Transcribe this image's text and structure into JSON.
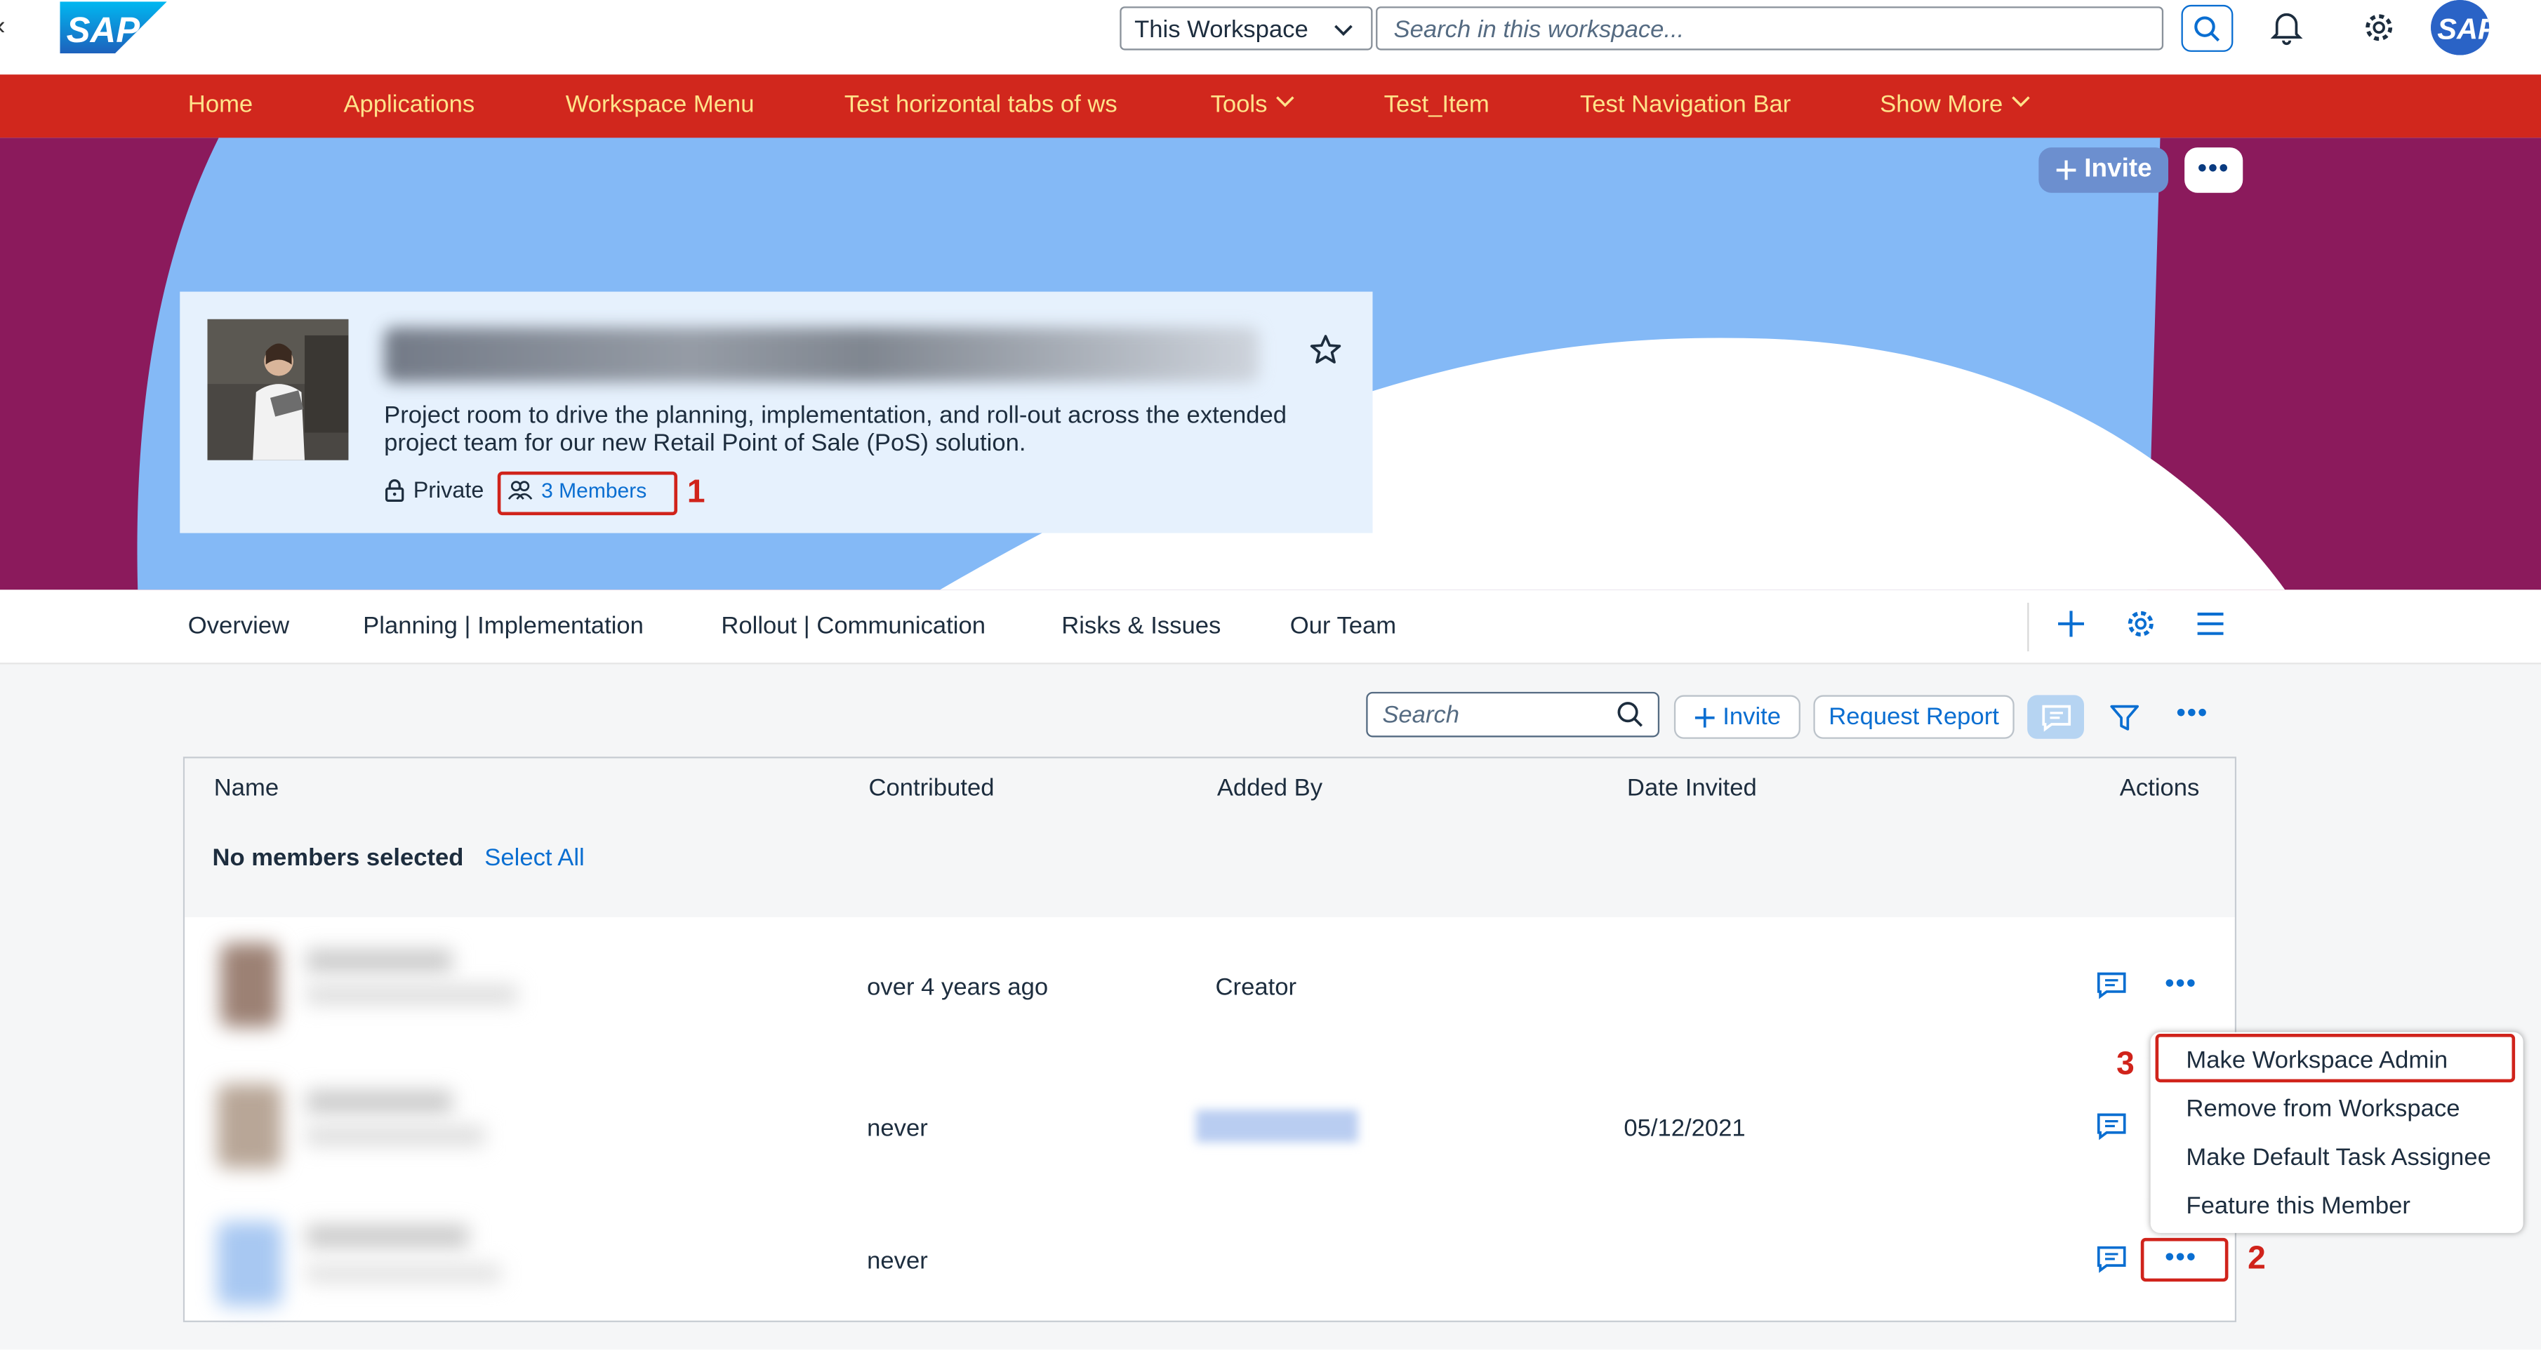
{
  "shell": {
    "scope_select": "This Workspace",
    "search_placeholder": "Search in this workspace...",
    "logo_text": "SAP"
  },
  "nav": {
    "items": [
      {
        "label": "Home"
      },
      {
        "label": "Applications"
      },
      {
        "label": "Workspace Menu"
      },
      {
        "label": "Test horizontal tabs of ws"
      },
      {
        "label": "Tools",
        "has_dropdown": true
      },
      {
        "label": "Test_Item"
      },
      {
        "label": "Test Navigation Bar"
      },
      {
        "label": "Show More",
        "has_dropdown": true
      }
    ]
  },
  "banner": {
    "invite_label": "Invite",
    "description": "Project room to drive the planning, implementation, and roll-out across the extended project team for our new Retail Point of Sale (PoS) solution.",
    "privacy": "Private",
    "members_link": "3 Members"
  },
  "tabs": [
    {
      "label": "Overview"
    },
    {
      "label": "Planning | Implementation"
    },
    {
      "label": "Rollout | Communication"
    },
    {
      "label": "Risks & Issues"
    },
    {
      "label": "Our Team"
    }
  ],
  "members": {
    "search_placeholder": "Search",
    "invite_label": "Invite",
    "request_report_label": "Request Report",
    "columns": [
      "Name",
      "Contributed",
      "Added By",
      "Date Invited",
      "Actions"
    ],
    "selection_text": "No members selected",
    "select_all_label": "Select All",
    "rows": [
      {
        "contributed": "over 4 years ago",
        "added_by": "Creator",
        "date_invited": ""
      },
      {
        "contributed": "never",
        "added_by": "",
        "date_invited": "05/12/2021"
      },
      {
        "contributed": "never",
        "added_by": "",
        "date_invited": ""
      }
    ]
  },
  "menu": {
    "items": [
      {
        "label": "Make Workspace Admin"
      },
      {
        "label": "Remove from Workspace"
      },
      {
        "label": "Make Default Task Assignee"
      },
      {
        "label": "Feature this Member"
      }
    ]
  },
  "annotations": {
    "step1": "1",
    "step2": "2",
    "step3": "3"
  },
  "colors": {
    "nav_bg": "#d1271d",
    "nav_text": "#ffe38a",
    "banner_purple": "#8b1a5c",
    "banner_blue": "#84b9f6",
    "accent": "#0a6ed1",
    "annotation_red": "#d0231b"
  }
}
